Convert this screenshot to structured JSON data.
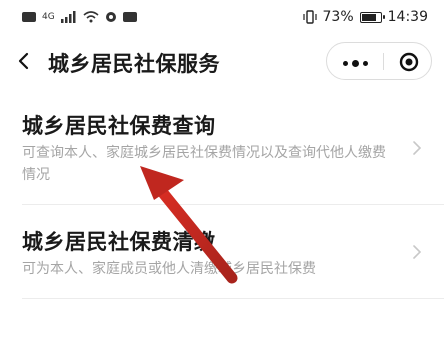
{
  "status_bar": {
    "battery_percent": "73%",
    "time": "14:39",
    "icons": [
      "sim-icon",
      "network-icon",
      "wifi-icon",
      "location-icon",
      "notification-icon",
      "vibrate-icon",
      "battery-icon"
    ]
  },
  "nav": {
    "title": "城乡居民社保服务",
    "back_icon": "chevron-left-icon",
    "more_icon": "more-dots-icon",
    "close_icon": "target-close-icon"
  },
  "list": [
    {
      "title": "城乡居民社保费查询",
      "description": "可查询本人、家庭城乡居民社保费情况以及查询代他人缴费情况"
    },
    {
      "title": "城乡居民社保费清缴",
      "description": "可为本人、家庭成员或他人清缴城乡居民社保费"
    }
  ],
  "colors": {
    "annotation_arrow": "#c0271f",
    "text_primary": "#1a1a1a",
    "text_secondary": "#a5a5a5",
    "chevron": "#c8c8c8"
  }
}
